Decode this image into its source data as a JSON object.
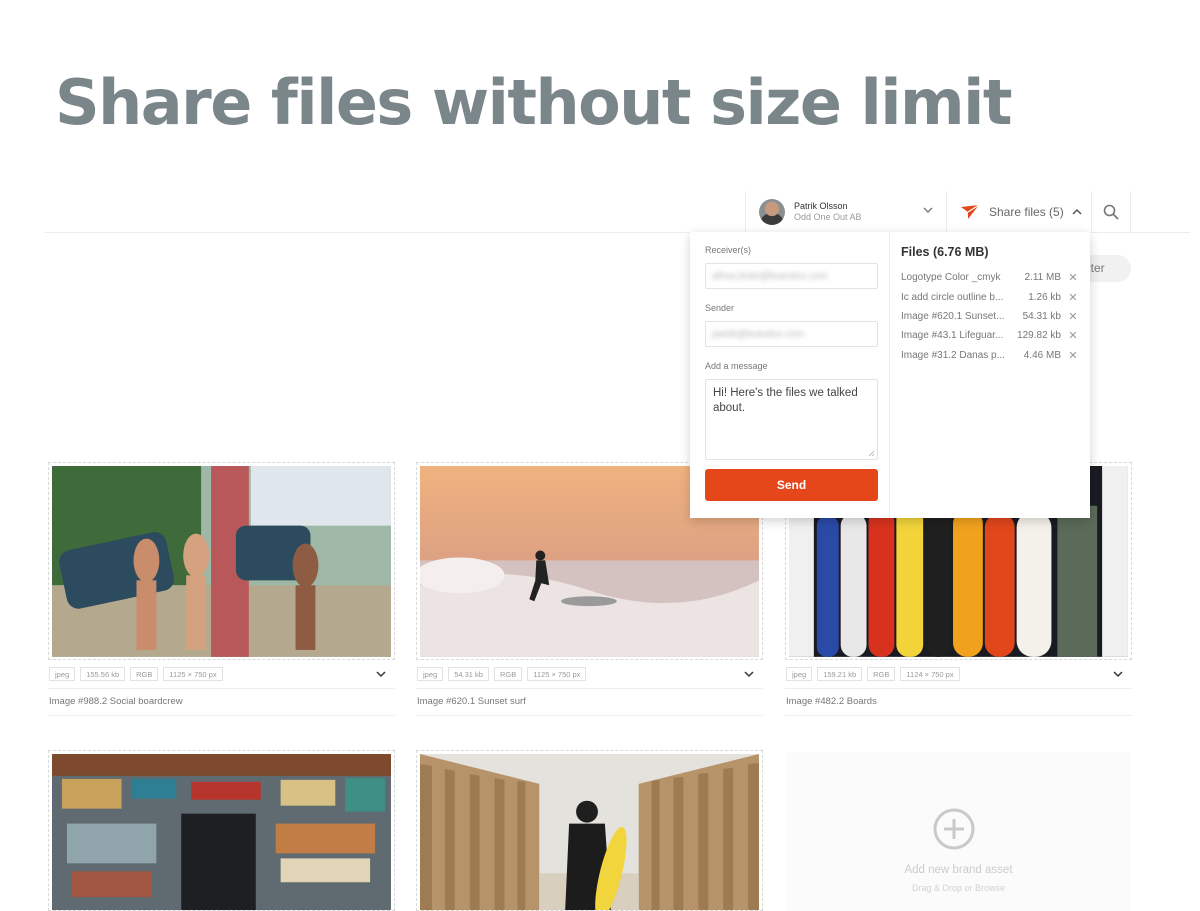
{
  "hero": {
    "title": "Share files without size limit"
  },
  "header": {
    "user": {
      "name": "Patrik Olsson",
      "company": "Odd One Out AB"
    },
    "share": {
      "label": "Share files (5)"
    },
    "filter_label": "lter"
  },
  "share_panel": {
    "receivers_label": "Receiver(s)",
    "receivers_value": "alhsa.lindo@brandox.com",
    "sender_label": "Sender",
    "sender_value": "patrik@brandox.com",
    "message_label": "Add a message",
    "message_value": "Hi! Here's the files we talked about.",
    "send_label": "Send",
    "files_title": "Files (6.76 MB)",
    "files": [
      {
        "name": "Logotype Color _cmyk",
        "size": "2.11 MB"
      },
      {
        "name": "Ic add circle outline b...",
        "size": "1.26 kb"
      },
      {
        "name": "Image #620.1 Sunset...",
        "size": "54.31 kb"
      },
      {
        "name": "Image #43.1 Lifeguar...",
        "size": "129.82 kb"
      },
      {
        "name": "Image #31.2 Danas p...",
        "size": "4.46 MB"
      }
    ],
    "remove_glyph": "✕"
  },
  "assets": [
    {
      "title": "Image #988.2 Social boardcrew",
      "tags": [
        "jpeg",
        "155.56 kb",
        "RGB",
        "1125 × 750 px"
      ]
    },
    {
      "title": "Image #620.1 Sunset surf",
      "tags": [
        "jpeg",
        "54.31 kb",
        "RGB",
        "1125 × 750 px"
      ]
    },
    {
      "title": "Image #482.2 Boards",
      "tags": [
        "jpeg",
        "159.21 kb",
        "RGB",
        "1124 × 750 px"
      ]
    },
    {
      "title": "",
      "tags": []
    },
    {
      "title": "",
      "tags": []
    }
  ],
  "add_asset": {
    "label": "Add new brand asset",
    "hint": "Drag & Drop or Browse"
  },
  "colors": {
    "accent": "#e6471a",
    "title_gray": "#7b868a"
  },
  "icons": [
    "avatar",
    "chevron-down-icon",
    "paper-plane-icon",
    "chevron-up-icon",
    "search-icon",
    "close-icon",
    "add-circle-icon"
  ]
}
